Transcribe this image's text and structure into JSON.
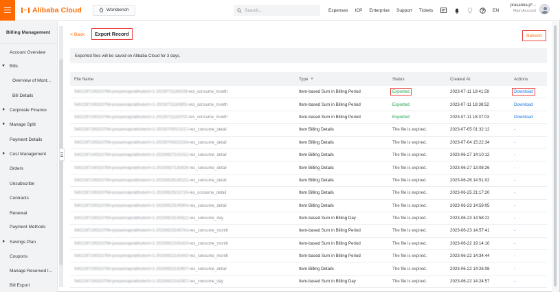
{
  "header": {
    "brand": "Alibaba Cloud",
    "workbench": "Workbench",
    "search_placeholder": "Search...",
    "nav": [
      "Expenses",
      "ICP",
      "Enterprise",
      "Support",
      "Tickets"
    ],
    "language": "EN",
    "user_name": "prasanna.p*...",
    "user_role": "Main Account",
    "icons": [
      "message-icon",
      "bell-icon",
      "lightbulb-icon",
      "help-icon"
    ]
  },
  "sidebar": {
    "title": "Billing Management",
    "items": [
      {
        "label": "Account Overview",
        "indent": 0,
        "caret": "none"
      },
      {
        "label": "Bills",
        "indent": 0,
        "caret": "open"
      },
      {
        "label": "Overview of Mont...",
        "indent": 1,
        "caret": "none"
      },
      {
        "label": "Bill Details",
        "indent": 1,
        "caret": "none"
      },
      {
        "label": "Corporate Finance",
        "indent": 0,
        "caret": "closed"
      },
      {
        "label": "Manage Split",
        "indent": 0,
        "caret": "closed"
      },
      {
        "label": "Payment Details",
        "indent": 0,
        "caret": "none"
      },
      {
        "label": "Cost Management",
        "indent": 0,
        "caret": "closed"
      },
      {
        "label": "Orders",
        "indent": 0,
        "caret": "none"
      },
      {
        "label": "Unsubscribe",
        "indent": 0,
        "caret": "none"
      },
      {
        "label": "Contracts",
        "indent": 0,
        "caret": "none"
      },
      {
        "label": "Renewal",
        "indent": 0,
        "caret": "none"
      },
      {
        "label": "Payment Methods",
        "indent": 0,
        "caret": "none"
      },
      {
        "label": "Savings Plan",
        "indent": 0,
        "caret": "closed"
      },
      {
        "label": "Coupons",
        "indent": 0,
        "caret": "none"
      },
      {
        "label": "Manage Reserved I...",
        "indent": 0,
        "caret": "none"
      },
      {
        "label": "Bill Export",
        "indent": 0,
        "caret": "none"
      }
    ]
  },
  "page": {
    "back_label": "< Back",
    "title": "Export Record",
    "refresh_label": "Refresh",
    "notice": "Exported files will be saved on Alibaba Cloud for 3 days."
  },
  "table": {
    "columns": [
      "File Name",
      "Type",
      "Status",
      "Created At",
      "Actions"
    ],
    "rows": [
      {
        "file_prefix": "5402287190310764-prasannaprabhutech=1-20230711184158",
        "file_suffix": "-res_consume_month",
        "type": "Item-based Sum in Billing Period",
        "status": "Exported",
        "created": "2023-07-11 18:41:59",
        "action": "Download",
        "highlight": true
      },
      {
        "file_prefix": "5402287190310764-prasannaprabhutech=1-20230711183851",
        "file_suffix": "-res_consume_month",
        "type": "Item-based Sum in Billing Period",
        "status": "Exported",
        "created": "2023-07-11 18:38:52",
        "action": "Download",
        "highlight": false
      },
      {
        "file_prefix": "5402287190310764-prasannaprabhutech=1-20230711183702",
        "file_suffix": "-res_consume_month",
        "type": "Item-based Sum in Billing Period",
        "status": "Exported",
        "created": "2023-07-11 18:37:03",
        "action": "Download",
        "highlight": false
      },
      {
        "file_prefix": "5402287190310764-prasannaprabhutech=1-20230705013217",
        "file_suffix": "-res_consume_detail",
        "type": "Item Billing Details",
        "status": "The file is expired.",
        "created": "2023-07-05 01:32:12",
        "action": "-",
        "highlight": false
      },
      {
        "file_prefix": "5402287190310764-prasannaprabhutech=1-20230704152234",
        "file_suffix": "-res_consume_detail",
        "type": "Item Billing Details",
        "status": "The file is expired.",
        "created": "2023-07-04 15:22:34",
        "action": "-",
        "highlight": false
      },
      {
        "file_prefix": "5402287190310764-prasannaprabhutech=1-20230627141012",
        "file_suffix": "-res_consume_detail",
        "type": "Item Billing Details",
        "status": "The file is expired.",
        "created": "2023-06-27 14:10:12",
        "action": "-",
        "highlight": false
      },
      {
        "file_prefix": "5402287190310764-prasannaprabhutech=1-20230627130826",
        "file_suffix": "-res_consume_detail",
        "type": "Item Billing Details",
        "status": "The file is expired.",
        "created": "2023-06-27 13:08:26",
        "action": "-",
        "highlight": false
      },
      {
        "file_prefix": "5402287190310764-prasannaprabhutech=1-20230626145101",
        "file_suffix": "-res_consume_detail",
        "type": "Item Billing Details",
        "status": "The file is expired.",
        "created": "2023-06-26 14:51:02",
        "action": "-",
        "highlight": false
      },
      {
        "file_prefix": "5402287190310764-prasannaprabhutech=1-20230625211719",
        "file_suffix": "-res_consume_detail",
        "type": "Item Billing Details",
        "status": "The file is expired.",
        "created": "2023-06-25 21:17:20",
        "action": "-",
        "highlight": false
      },
      {
        "file_prefix": "5402287190310764-prasannaprabhutech=1-20230623145904",
        "file_suffix": "-res_consume_detail",
        "type": "Item Billing Details",
        "status": "The file is expired.",
        "created": "2023-06-23 14:59:05",
        "action": "-",
        "highlight": false
      },
      {
        "file_prefix": "5402287190310764-prasannaprabhutech=1-20230623145822",
        "file_suffix": "-res_consume_day",
        "type": "Item-based Sum in Billing Day",
        "status": "The file is expired.",
        "created": "2023-06-23 14:58:22",
        "action": "-",
        "highlight": false
      },
      {
        "file_prefix": "5402287190310764-prasannaprabhutech=1-20230623145741",
        "file_suffix": "-res_consume_month",
        "type": "Item-based Sum in Billing Period",
        "status": "The file is expired.",
        "created": "2023-06-23 14:57:41",
        "action": "-",
        "highlight": false
      },
      {
        "file_prefix": "5402287190310764-prasannaprabhutech=1-20230622191410",
        "file_suffix": "-res_consume_month",
        "type": "Item-based Sum in Billing Period",
        "status": "The file is expired.",
        "created": "2023-06-22 19:14:10",
        "action": "-",
        "highlight": false
      },
      {
        "file_prefix": "5402287190310764-prasannaprabhutech=1-20230622143443",
        "file_suffix": "-res_consume_month",
        "type": "Item-based Sum in Billing Period",
        "status": "The file is expired.",
        "created": "2023-06-22 14:34:44",
        "action": "-",
        "highlight": false
      },
      {
        "file_prefix": "5402287190310764-prasannaprabhutech=1-20230622142607",
        "file_suffix": "-res_consume_detail",
        "type": "Item Billing Details",
        "status": "The file is expired.",
        "created": "2023-06-22 14:26:08",
        "action": "-",
        "highlight": false
      },
      {
        "file_prefix": "5402287190310764-prasannaprabhutech=1-20230622142457",
        "file_suffix": "-res_consume_day",
        "type": "Item-based Sum in Billing Day",
        "status": "The file is expired.",
        "created": "2023-06-22 14:24:57",
        "action": "-",
        "highlight": false
      }
    ]
  },
  "colors": {
    "brand": "#ff6a00",
    "exported": "#1aa34a",
    "link": "#1a73e8",
    "highlight_box": "#e8423d"
  }
}
